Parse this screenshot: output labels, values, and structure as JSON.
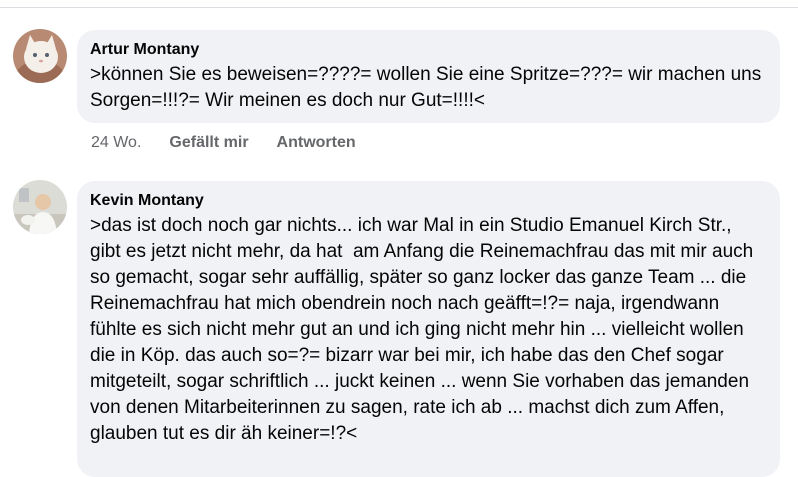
{
  "comments": [
    {
      "author": "Artur Montany",
      "avatar": "white-cat-avatar",
      "text": ">können Sie es beweisen=????= wollen Sie eine Spritze=???= wir machen uns Sorgen=!!!?= Wir meinen es doch nur Gut=!!!!<",
      "time": "24 Wo.",
      "like_label": "Gefällt mir",
      "reply_label": "Antworten"
    },
    {
      "author": "Kevin Montany",
      "avatar": "person-photo-avatar",
      "text": ">das ist doch noch gar nichts... ich war Mal in ein Studio Emanuel Kirch Str., gibt es jetzt nicht mehr, da hat  am Anfang die Reinemachfrau das mit mir auch so gemacht, sogar sehr auffällig, später so ganz locker das ganze Team ... die Reinemachfrau hat mich obendrein noch nach geäfft=!?= naja, irgendwann fühlte es sich nicht mehr gut an und ich ging nicht mehr hin ... vielleicht wollen die in Köp. das auch so=?= bizarr war bei mir, ich habe das den Chef sogar mitgeteilt, sogar schriftlich ... juckt keinen ... wenn Sie vorhaben das jemanden von denen Mitarbeiterinnen zu sagen, rate ich ab ... machst dich zum Affen, glauben tut es dir äh keiner=!?<"
    }
  ],
  "colors": {
    "bubble_bg": "#f0f2f5",
    "text": "#050505",
    "secondary_text": "#65676b"
  }
}
